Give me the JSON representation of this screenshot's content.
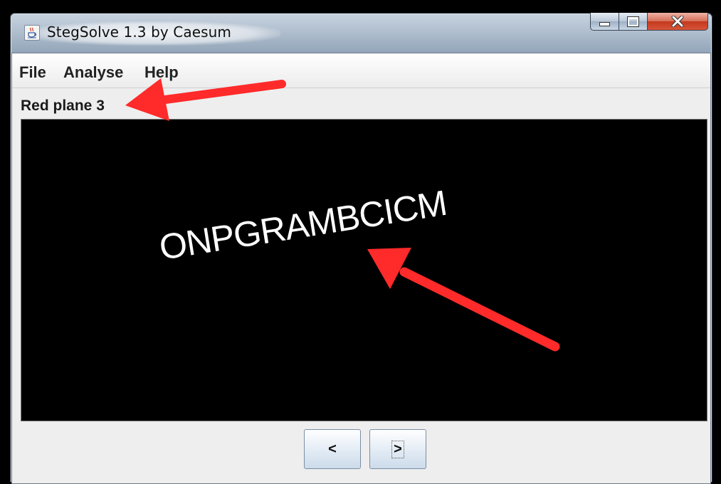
{
  "window": {
    "title": "StegSolve 1.3 by Caesum"
  },
  "menu": {
    "items": [
      {
        "label": "File"
      },
      {
        "label": "Analyse"
      },
      {
        "label": "Help"
      }
    ]
  },
  "status": {
    "label": "Red plane 3"
  },
  "image": {
    "hidden_text": "ONPGRAMBCICM",
    "background": "#000000",
    "text_color": "#ffffff"
  },
  "navigation": {
    "prev_label": "<",
    "next_label": ">"
  },
  "annotations": {
    "arrow_color": "#ff2a2a"
  },
  "icons": {
    "app": "java-cup-icon",
    "minimize": "minimize-icon",
    "maximize": "maximize-icon",
    "close": "close-icon"
  }
}
